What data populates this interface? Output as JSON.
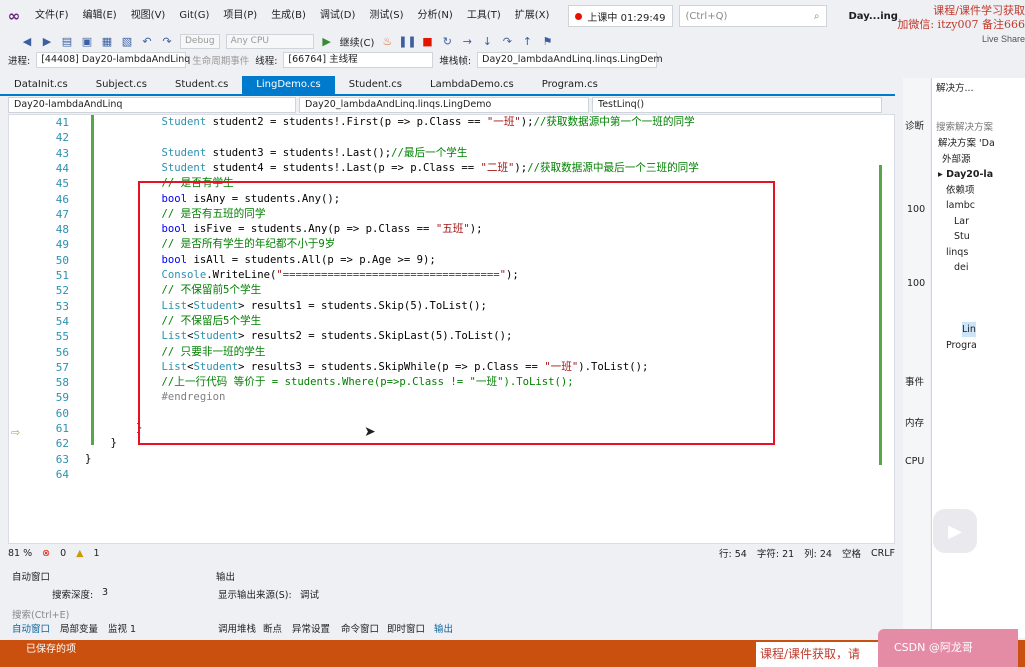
{
  "menubar": {
    "items": [
      "文件(F)",
      "编辑(E)",
      "视图(V)",
      "Git(G)",
      "项目(P)",
      "生成(B)",
      "调试(D)",
      "测试(S)",
      "分析(N)",
      "工具(T)",
      "扩展(X)"
    ],
    "live": "上课中 01:29:49",
    "search_placeholder": "(Ctrl+Q)",
    "window_title": "Day...ing",
    "watermark_line1": "课程/课件学习获取",
    "watermark_line2": "加微信: itzy007 备注666",
    "live_share": "Live Share"
  },
  "toolbar": {
    "config": "Debug",
    "platform": "Any CPU",
    "continue": "继续(C)"
  },
  "debugbar": {
    "process_label": "进程:",
    "process": "[44408] Day20-lambdaAndLinq",
    "lifecycle": "生命周期事件",
    "thread_label": "线程:",
    "thread": "[66764] 主线程",
    "stack_label": "堆栈帧:",
    "stack": "Day20_lambdaAndLinq.linqs.LingDem"
  },
  "tabs": [
    "DataInit.cs",
    "Subject.cs",
    "Student.cs",
    "LingDemo.cs",
    "Student.cs",
    "LambdaDemo.cs",
    "Program.cs"
  ],
  "active_tab_index": 3,
  "navbar": {
    "project": "Day20-lambdaAndLinq",
    "class": "Day20_lambdaAndLinq.linqs.LingDemo",
    "method": "TestLinq()"
  },
  "code": {
    "line_numbers": [
      "41",
      "42",
      "43",
      "44",
      "45",
      "46",
      "47",
      "48",
      "49",
      "50",
      "51",
      "52",
      "53",
      "54",
      "55",
      "56",
      "57",
      "58",
      "59",
      "60",
      "61",
      "62",
      "63",
      "64"
    ],
    "lines": [
      "            Student student2 = students!.First(p => p.Class == \"一班\");//获取数据源中第一个一班的同学",
      "",
      "            Student student3 = students!.Last();//最后一个学生",
      "            Student student4 = students!.Last(p => p.Class == \"二班\");//获取数据源中最后一个三班的同学",
      "            // 是否有学生",
      "            bool isAny = students.Any();",
      "            // 是否有五班的同学",
      "            bool isFive = students.Any(p => p.Class == \"五班\");",
      "            // 是否所有学生的年纪都不小于9岁",
      "            bool isAll = students.All(p => p.Age >= 9);",
      "            Console.WriteLine(\"==================================\");",
      "            // 不保留前5个学生",
      "            List<Student> results1 = students.Skip(5).ToList();",
      "            // 不保留后5个学生",
      "            List<Student> results2 = students.SkipLast(5).ToList();",
      "            // 只要非一班的学生",
      "            List<Student> results3 = students.SkipWhile(p => p.Class == \"一班\").ToList();",
      "            //上一行代码 等价于 = students.Where(p=>p.Class != \"一班\").ToList();",
      "            #endregion",
      "",
      "        }",
      "    }",
      "}",
      ""
    ]
  },
  "statusbar": {
    "zoom": "81 %",
    "errors": "0",
    "warnings": "1",
    "line": "行: 54",
    "char": "字符: 21",
    "col": "列: 24",
    "space": "空格",
    "crlf": "CRLF"
  },
  "autos": {
    "title": "自动窗口",
    "search_depth_label": "搜索深度:",
    "search_depth": "3",
    "search_placeholder": "搜索(Ctrl+E)",
    "tabs": [
      "自动窗口",
      "局部变量",
      "监视 1"
    ]
  },
  "output": {
    "title": "输出",
    "source_label": "显示输出来源(S):",
    "source": "调试",
    "tabs": [
      "调用堆栈",
      "断点",
      "异常设置",
      "命令窗口",
      "即时窗口",
      "输出"
    ]
  },
  "sidestrip": [
    "诊断",
    "100",
    "100",
    "事件",
    "内存",
    "CPU"
  ],
  "solution": {
    "title": "解决方...",
    "search": "搜索解决方案",
    "items": [
      "解决方案 'Da",
      "外部源",
      "Day20-la",
      "依赖项",
      "lambc",
      "Lar",
      "Stu",
      "linqs",
      "dei",
      "",
      "",
      "",
      "Lin",
      "Progra"
    ]
  },
  "bottom": {
    "saved": "已保存的项",
    "banner": "课程/课件获取，请",
    "pink": "CSDN @阿龙哥"
  }
}
